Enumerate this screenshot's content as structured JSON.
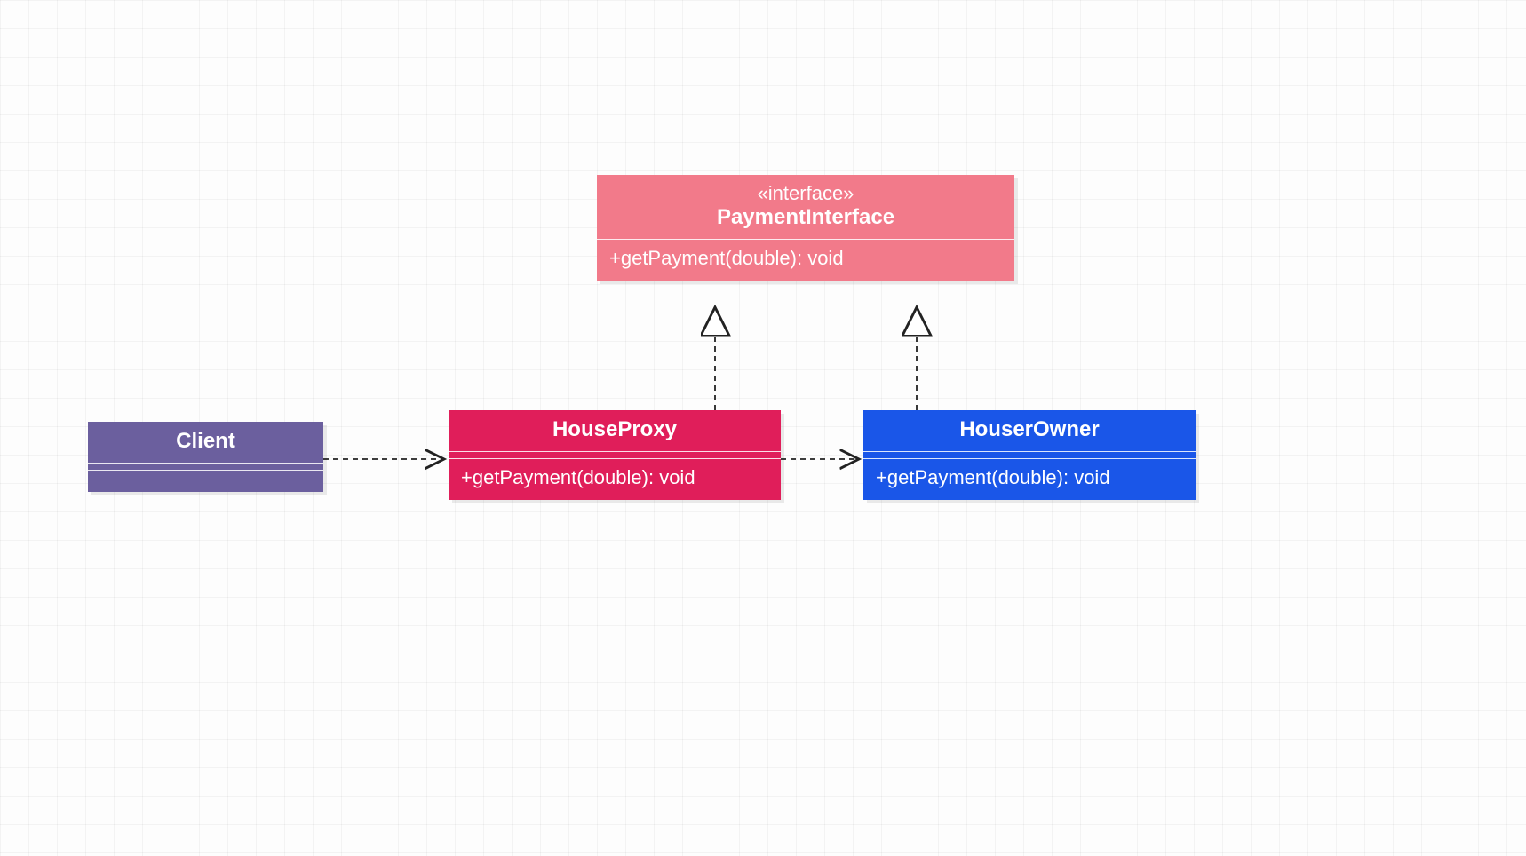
{
  "diagram": {
    "interface": {
      "stereotype": "«interface»",
      "name": "PaymentInterface",
      "operation": "+getPayment(double): void"
    },
    "client": {
      "name": "Client"
    },
    "proxy": {
      "name": "HouseProxy",
      "operation": "+getPayment(double): void"
    },
    "owner": {
      "name": "HouserOwner",
      "operation": "+getPayment(double): void"
    }
  }
}
